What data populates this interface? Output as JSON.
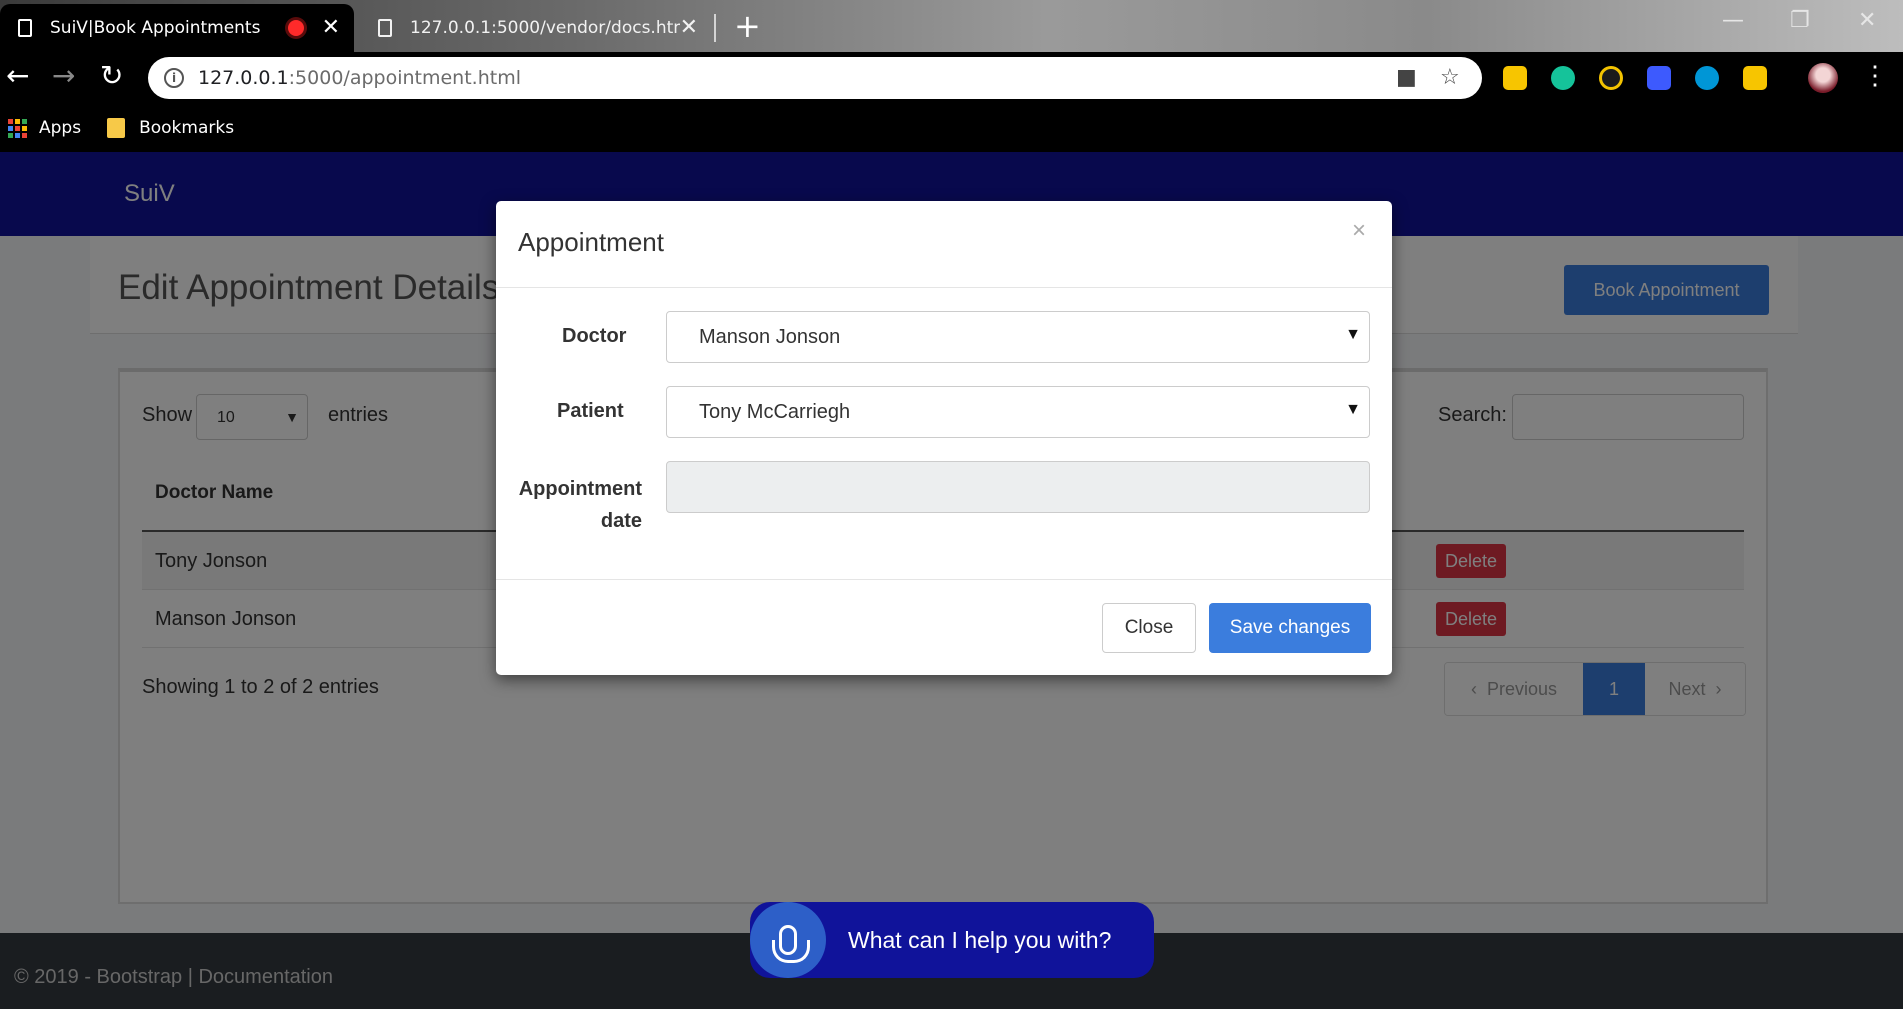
{
  "browser": {
    "tabs": [
      {
        "title": "SuiV|Book Appointments",
        "active": true
      },
      {
        "title": "127.0.0.1:5000/vendor/docs.html",
        "active": false
      }
    ],
    "url_host": "127.0.0.1",
    "url_path": ":5000/appointment.html",
    "bookmarks": [
      {
        "label": "Apps",
        "icon": "apps-grid-icon"
      },
      {
        "label": "Bookmarks",
        "icon": "folder-icon"
      }
    ]
  },
  "navbar": {
    "brand": "SuiV"
  },
  "page": {
    "title": "Edit Appointment Details",
    "book_button": "Book Appointment"
  },
  "table": {
    "show_label": "Show",
    "entries_value": "10",
    "entries_label": "entries",
    "search_label": "Search:",
    "columns": [
      "Doctor Name"
    ],
    "rows": [
      {
        "doctor": "Tony Jonson",
        "action": "Delete"
      },
      {
        "doctor": "Manson Jonson",
        "action": "Delete"
      }
    ],
    "info": "Showing 1 to 2 of 2 entries",
    "pagination": {
      "previous": "Previous",
      "current": "1",
      "next": "Next"
    }
  },
  "modal": {
    "title": "Appointment",
    "close_symbol": "×",
    "doctor_label": "Doctor",
    "doctor_value": "Manson Jonson",
    "patient_label": "Patient",
    "patient_value": "Tony McCarriegh",
    "date_label_line1": "Appointment",
    "date_label_line2": "date",
    "date_value": "",
    "close_button": "Close",
    "save_button": "Save changes"
  },
  "footer": {
    "text": "© 2019 - Bootstrap | Documentation"
  },
  "assistant": {
    "prompt": "What can I help you with?"
  },
  "colors": {
    "navbar": "#10139a",
    "primary": "#3b7ddd",
    "danger": "#dc3545",
    "footer": "#343a40"
  }
}
